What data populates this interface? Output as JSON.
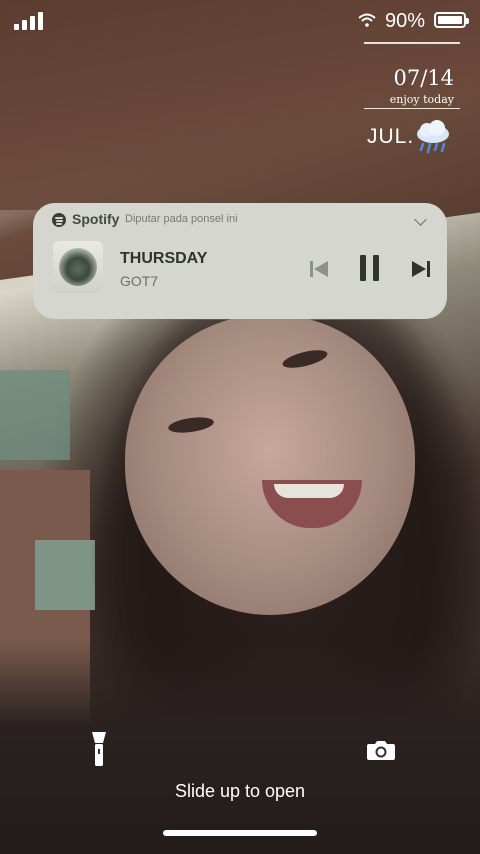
{
  "status_bar": {
    "battery_percent": "90%",
    "battery_level": 0.9,
    "signal_bars": 4
  },
  "widget": {
    "date": "07/14",
    "tagline": "enjoy today",
    "month": "JUL.",
    "weather_icon": "rain-cloud-icon"
  },
  "media_notification": {
    "app_name": "Spotify",
    "subtitle": "Diputar pada ponsel ini",
    "track_title": "THURSDAY",
    "artist": "GOT7",
    "controls": [
      "previous-icon",
      "pause-icon",
      "next-icon"
    ],
    "accent_color": "#3b3e38",
    "card_color": "#d4d6cf"
  },
  "lock_screen": {
    "slide_text": "Slide up to open",
    "left_shortcut_icon": "flashlight-icon",
    "right_shortcut_icon": "camera-icon"
  }
}
